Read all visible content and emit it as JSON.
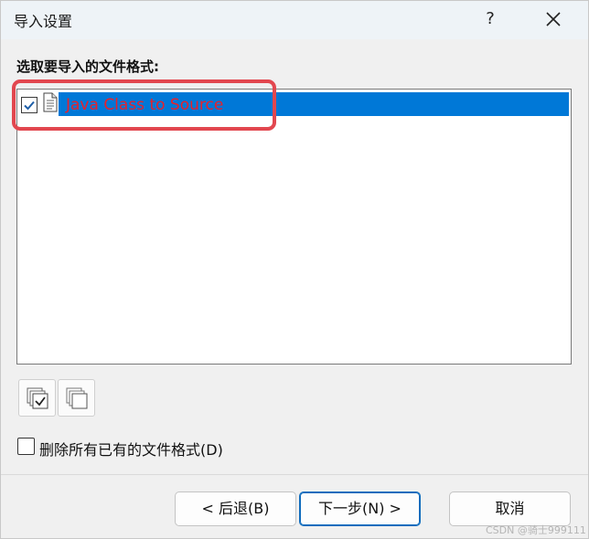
{
  "window": {
    "title": "导入设置",
    "help_label": "?",
    "close_icon": "close-icon"
  },
  "prompt": "选取要导入的文件格式:",
  "list": {
    "items": [
      {
        "label": "Java Class to Source",
        "checked": true,
        "selected": true,
        "icon": "document-icon"
      }
    ]
  },
  "icon_buttons": {
    "select_all_icon": "select-all-icon",
    "select_none_icon": "select-none-icon"
  },
  "delete_option": {
    "label": "删除所有已有的文件格式(D)",
    "checked": false
  },
  "buttons": {
    "back": "< 后退(B)",
    "next": "下一步(N) >",
    "cancel": "取消"
  },
  "watermark": "CSDN @骑士999111",
  "colors": {
    "selection": "#0078d7",
    "item_text": "#e8212b",
    "highlight": "#e2474f",
    "default_button_border": "#0f6cbd"
  }
}
